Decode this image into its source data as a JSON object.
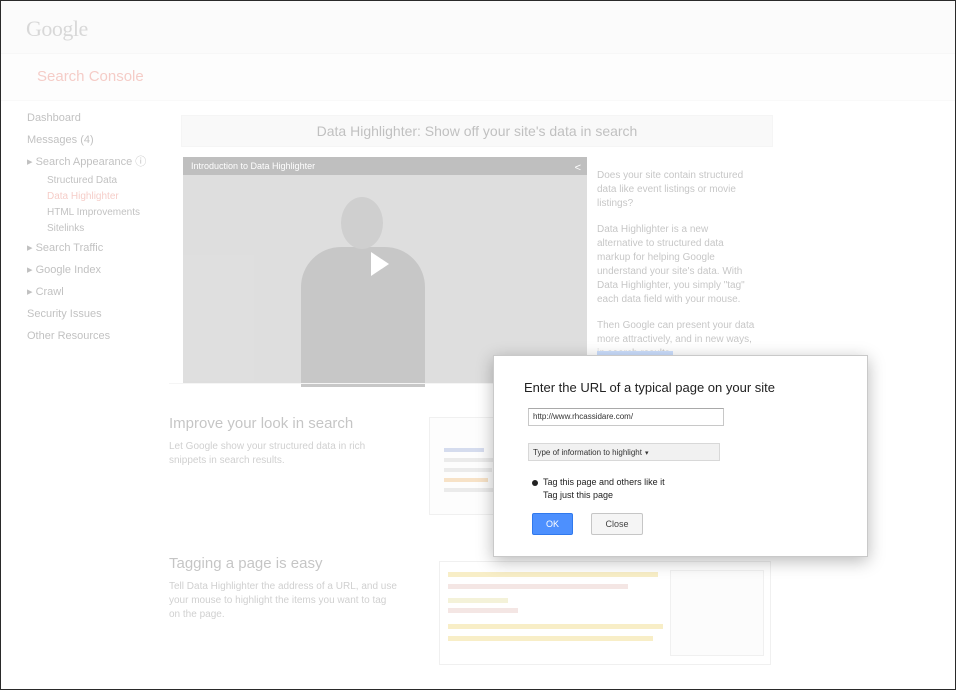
{
  "header": {
    "logo": "Google",
    "product": "Search Console"
  },
  "sidebar": {
    "items": [
      {
        "label": "Dashboard",
        "sub": false,
        "selected": false
      },
      {
        "label": "Messages (4)",
        "sub": false,
        "selected": false
      },
      {
        "label": "▸ Search Appearance ⓘ",
        "sub": false,
        "selected": false
      },
      {
        "label": "Structured Data",
        "sub": true,
        "selected": false
      },
      {
        "label": "Data Highlighter",
        "sub": true,
        "selected": true
      },
      {
        "label": "HTML Improvements",
        "sub": true,
        "selected": false
      },
      {
        "label": "Sitelinks",
        "sub": true,
        "selected": false
      },
      {
        "label": "▸ Search Traffic",
        "sub": false,
        "selected": false
      },
      {
        "label": "▸ Google Index",
        "sub": false,
        "selected": false
      },
      {
        "label": "▸ Crawl",
        "sub": false,
        "selected": false
      },
      {
        "label": "Security Issues",
        "sub": false,
        "selected": false
      },
      {
        "label": "Other Resources",
        "sub": false,
        "selected": false
      }
    ]
  },
  "main": {
    "hero_title": "Data Highlighter: Show off your site's data in search",
    "video": {
      "title": "Introduction to Data Highlighter"
    },
    "intro_paragraphs": [
      "Does your site contain structured data like event listings or movie listings?",
      "Data Highlighter is a new alternative to structured data markup for helping Google understand your site's data. With Data Highlighter, you simply \"tag\" each data field with your mouse.",
      "Then Google can present your data more attractively, and in new ways, in search results."
    ],
    "section1": {
      "title": "Improve your look in search",
      "body": "Let Google show your structured data in rich snippets in search results."
    },
    "section2": {
      "title": "Tagging a page is easy",
      "body": "Tell Data Highlighter the address of a URL, and use your mouse to highlight the items you want to tag on the page."
    }
  },
  "dialog": {
    "title": "Enter the URL of a typical page on your site",
    "url_value": "http://www.rhcassidare.com/",
    "type_select_label": "Type of information to highlight",
    "radio_options": [
      {
        "label": "Tag this page and others like it",
        "selected": true
      },
      {
        "label": "Tag just this page",
        "selected": false
      }
    ],
    "ok_label": "OK",
    "close_label": "Close"
  }
}
